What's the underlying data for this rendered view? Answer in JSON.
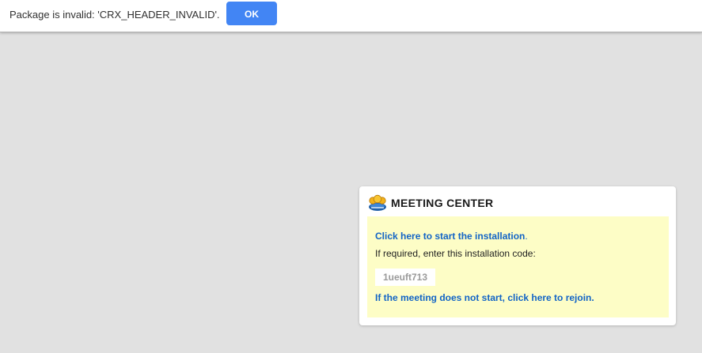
{
  "infobar": {
    "message": "Package is invalid: 'CRX_HEADER_INVALID'.",
    "ok_label": "OK",
    "accent_color": "#4285f4"
  },
  "meeting": {
    "logo_icon": "meeting-center-logo-icon",
    "title": "MEETING CENTER",
    "install_link": "Click here to start the installation",
    "install_period": ".",
    "note": "If required, enter this installation code:",
    "code": "1ueuft713",
    "rejoin_link": "If the meeting does not start, click here to rejoin.",
    "panel_background": "#fdfdc6",
    "link_color": "#1264c6"
  }
}
